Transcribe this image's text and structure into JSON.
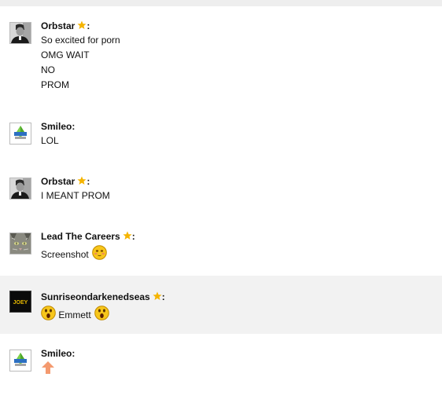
{
  "messages": [
    {
      "author": "Orbstar",
      "star": true,
      "avatar_icon": "grayscale-portrait-avatar",
      "lines": [
        "So excited for porn",
        "OMG WAIT",
        "NO",
        "PROM"
      ]
    },
    {
      "author": "Smileo",
      "star": false,
      "avatar_icon": "sims-plumbob-avatar",
      "lines": [
        "LOL"
      ]
    },
    {
      "author": "Orbstar",
      "star": true,
      "avatar_icon": "grayscale-portrait-avatar",
      "lines": [
        "I MEANT PROM"
      ]
    },
    {
      "author": "Lead The Careers",
      "star": true,
      "avatar_icon": "cat-face-avatar",
      "lines": [
        "Screenshot"
      ],
      "trailing_icon": "blushing-smiley-icon"
    },
    {
      "author": "Sunriseondarkenedseas",
      "star": true,
      "highlighted": true,
      "avatar_icon": "joey-text-avatar",
      "avatar_text": "JOEY",
      "lines": [
        "Emmett"
      ],
      "leading_icon": "surprised-smiley-icon",
      "trailing_icon": "surprised-smiley-icon"
    },
    {
      "author": "Smileo",
      "star": false,
      "avatar_icon": "sims-plumbob-avatar",
      "lines": [],
      "content_icon": "orange-up-arrow-icon"
    }
  ],
  "colors": {
    "star": "#f5b400",
    "highlight_row": "#f2f2f2",
    "smiley": "#f7c61b",
    "arrow": "#f49a6f"
  }
}
